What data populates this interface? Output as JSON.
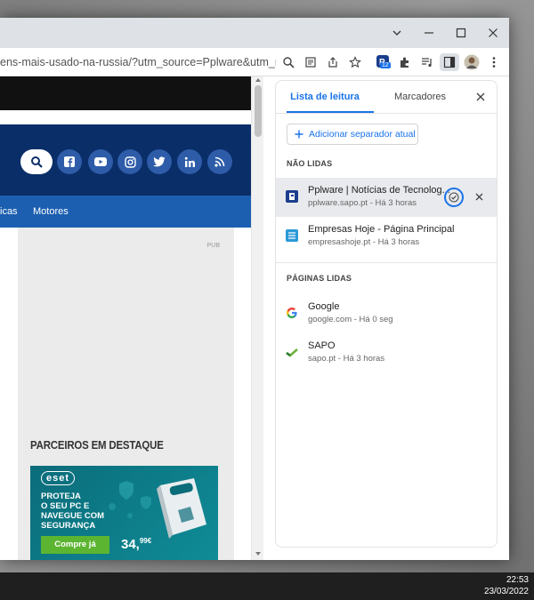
{
  "browser": {
    "url": "ens-mais-usado-na-russia/?utm_source=Pplware&utm_mediu...",
    "extension_badge": "12"
  },
  "page": {
    "nav_items": [
      "icas",
      "Motores"
    ],
    "ad_tag": "PUB",
    "partners_heading": "PARCEIROS EM DESTAQUE",
    "eset": {
      "logo": "eset",
      "headline": [
        "PROTEJA",
        "O SEU PC E",
        "NAVEGUE COM",
        "SEGURANÇA"
      ],
      "cta": "Compre já",
      "price": "34,",
      "price_cents": "99€"
    }
  },
  "side_panel": {
    "tabs": [
      "Lista de leitura",
      "Marcadores"
    ],
    "add_button": "Adicionar separador atual",
    "unread_title": "NÃO LIDAS",
    "read_title": "PÁGINAS LIDAS",
    "unread": [
      {
        "title": "Pplware | Notícias de Tecnolog...",
        "subtitle": "pplware.sapo.pt - Há 3 horas"
      },
      {
        "title": "Empresas Hoje - Página Principal",
        "subtitle": "empresashoje.pt - Há 3 horas"
      }
    ],
    "read": [
      {
        "title": "Google",
        "subtitle": "google.com - Há 0 seg"
      },
      {
        "title": "SAPO",
        "subtitle": "sapo.pt - Há 3 horas"
      }
    ]
  },
  "taskbar": {
    "time": "22:53",
    "date": "23/03/2022"
  },
  "colors": {
    "accent": "#1a73e8",
    "header_blue": "#0a2e68",
    "nav_blue": "#1c5fb0",
    "eset_teal": "#0a7a86",
    "eset_green": "#5cb531"
  }
}
